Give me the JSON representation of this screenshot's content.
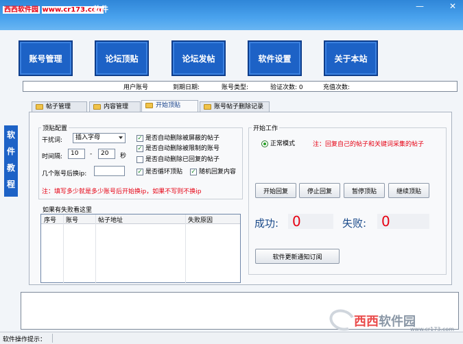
{
  "watermark_top": {
    "site": "西西软件园",
    "url": "www.cr173.com"
  },
  "title_suffix": "软件",
  "window_controls": {
    "minimize": "—",
    "close": "✕"
  },
  "toolbar": [
    {
      "label": "账号管理"
    },
    {
      "label": "论坛顶贴"
    },
    {
      "label": "论坛发帖"
    },
    {
      "label": "软件设置"
    },
    {
      "label": "关于本站"
    }
  ],
  "info": {
    "user": "用户账号",
    "expire": "到期日期:",
    "type": "账号类型:",
    "verify": "验证次数: 0",
    "recharge": "充值次数:"
  },
  "side_tab": [
    "软",
    "件",
    "教",
    "程"
  ],
  "tabs": [
    {
      "label": "帖子管理"
    },
    {
      "label": "内容管理"
    },
    {
      "label": "开始顶贴"
    },
    {
      "label": "账号帖子删除记录"
    }
  ],
  "config": {
    "title": "顶贴配置",
    "interference_label": "干扰词:",
    "interference_value": "插入字母",
    "interval_label": "时间隔:",
    "interval_from": "10",
    "interval_dash": "-",
    "interval_to": "20",
    "interval_unit": "秒",
    "switch_label": "几个账号后换ip:",
    "switch_value": "",
    "checkboxes": [
      {
        "label": "是否自动删除被屏蔽的帖子",
        "checked": true
      },
      {
        "label": "是否自动删除被限制的账号",
        "checked": true
      },
      {
        "label": "是否自动删除已回复的帖子",
        "checked": false
      },
      {
        "label": "是否循环顶贴",
        "checked": true
      },
      {
        "label": "随机回复内容",
        "checked": true
      }
    ],
    "note": "注：填写多少就是多少账号后开始换ip，如果不写则不换ip"
  },
  "fail_table": {
    "title": "如果有失败看这里",
    "columns": [
      "序号",
      "账号",
      "帖子地址",
      "失败原因"
    ],
    "rows": []
  },
  "start": {
    "title": "开始工作",
    "mode": "正常模式",
    "mode_note": "注：回复自己的帖子和关键词采集的帖子",
    "buttons": [
      "开始回复",
      "停止回复",
      "暂停顶贴",
      "继续顶贴"
    ],
    "success_label": "成功:",
    "success_value": "0",
    "fail_label": "失败:",
    "fail_value": "0",
    "notify_button": "软件更新通知订阅"
  },
  "status": {
    "label": "软件操作提示："
  },
  "watermark_bottom": {
    "brand_a": "西西",
    "brand_b": "软件园",
    "site": "www.cr173.com"
  }
}
